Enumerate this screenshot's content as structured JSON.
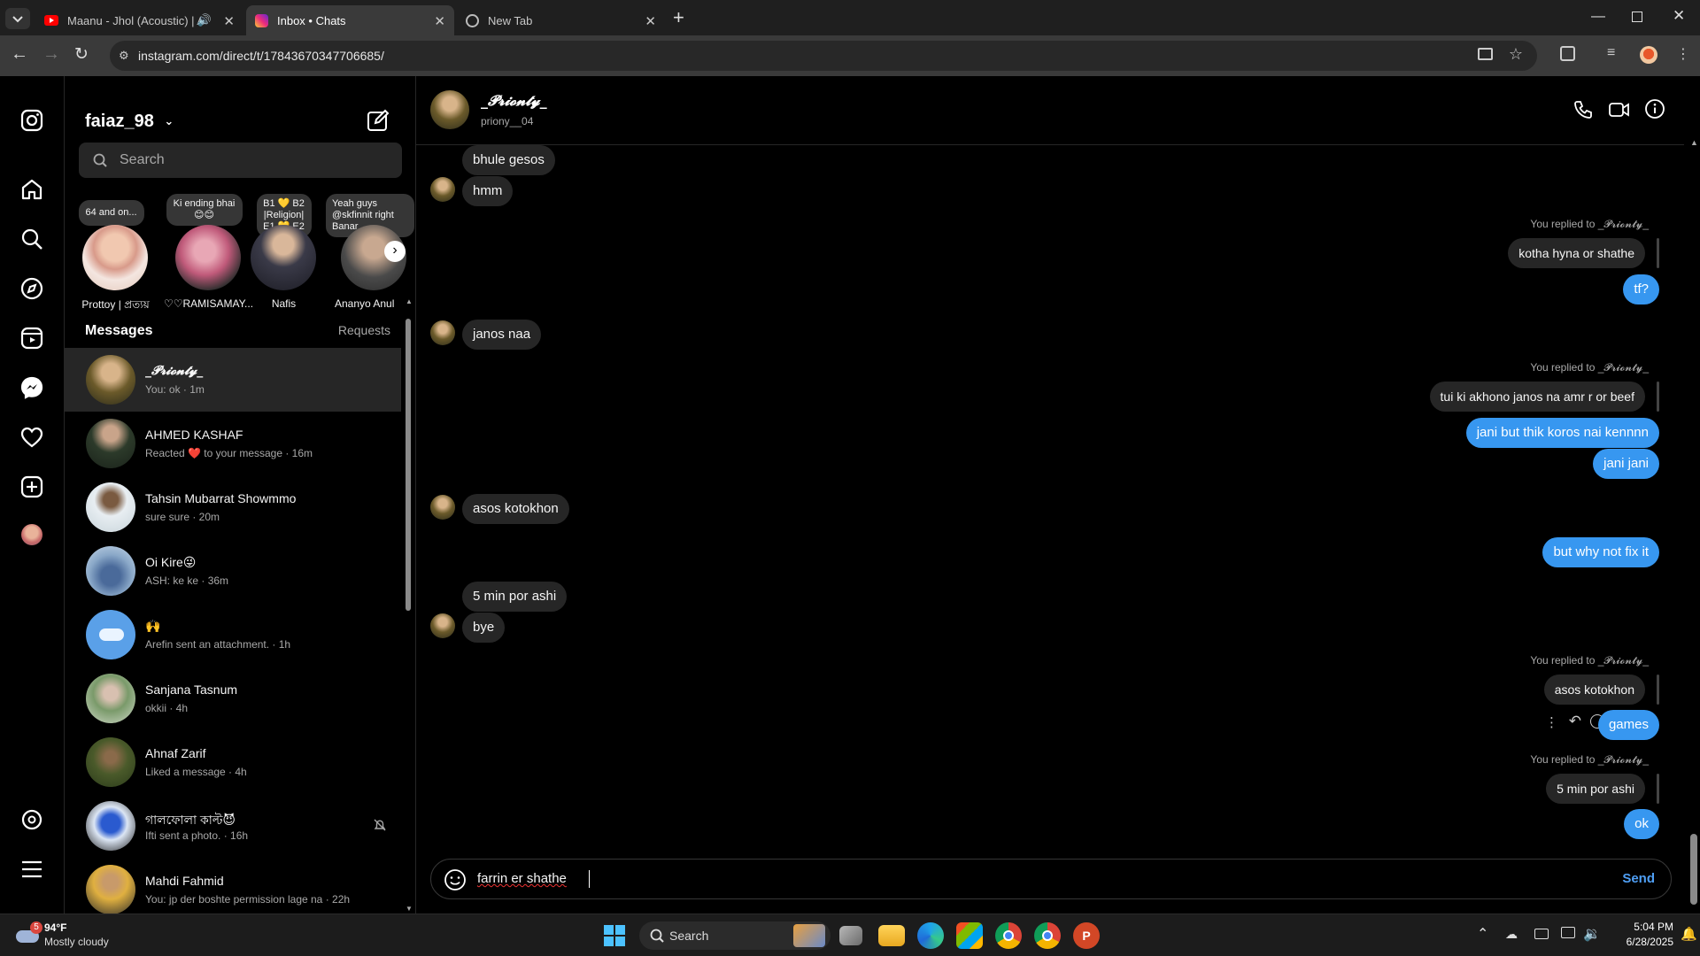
{
  "browser": {
    "tabs": [
      {
        "title": "Maanu - Jhol (Acoustic) | Ar",
        "active": false
      },
      {
        "title": "Inbox • Chats",
        "active": true
      },
      {
        "title": "New Tab",
        "active": false
      }
    ],
    "new_tab": "+",
    "url": "instagram.com/direct/t/17843670347706685/"
  },
  "inbox": {
    "username": "faiaz_98",
    "search_placeholder": "Search",
    "notes": [
      {
        "note": "64 and on...",
        "name": "Prottoy | প্রত্যয়"
      },
      {
        "note": "Ki ending bhai 😊😊",
        "name": "♡♡RAMISAMAY..."
      },
      {
        "note": "B1 💛 B2 |Religion| E1 💛 E2",
        "name": "Nafis"
      },
      {
        "note": "Yeah guys @skfinnit right Banar",
        "name": "Ananyo Anul"
      }
    ],
    "messages_heading": "Messages",
    "requests_label": "Requests",
    "conversations": [
      {
        "name": "_𝓟𝓻𝓲𝓸𝓷𝓽𝔂_",
        "preview": "You: ok · 1m",
        "active": true
      },
      {
        "name": "AHMED KASHAF",
        "preview": "Reacted ❤️ to your message · 16m",
        "active": false
      },
      {
        "name": "Tahsin Mubarrat Showmmo",
        "preview": "sure sure · 20m",
        "active": false
      },
      {
        "name": "Oi Kire😜",
        "preview": "ASH: ke ke · 36m",
        "active": false
      },
      {
        "name": "🙌",
        "preview": "Arefin sent an attachment. · 1h",
        "active": false
      },
      {
        "name": "Sanjana Tasnum",
        "preview": "okkii · 4h",
        "active": false
      },
      {
        "name": "Ahnaf Zarif",
        "preview": "Liked a message · 4h",
        "active": false
      },
      {
        "name": "গালফোলা কাল্ট😈",
        "preview": "Ifti sent a photo. · 16h",
        "active": false
      },
      {
        "name": "Mahdi Fahmid",
        "preview": "You: jp der boshte permission lage na · 22h",
        "active": false
      }
    ]
  },
  "chat": {
    "title": "_𝓟𝓻𝓲𝓸𝓷𝓽𝔂_",
    "subtitle": "priony__04",
    "reply_label": "You replied to _𝓟𝓻𝓲𝓸𝓷𝓽𝔂_",
    "messages": {
      "m1": "bhule gesos",
      "m2": "hmm",
      "q1": "kotha hyna or shathe",
      "m3": "tf?",
      "m4": "janos naa",
      "q2": "tui ki akhono janos na amr r or beef",
      "m5": "jani but thik koros nai kennnn",
      "m6": "jani jani",
      "m7": "asos kotokhon",
      "m8": "but why not fix it",
      "m9": "5 min por ashi",
      "m10": "bye",
      "q3": "asos kotokhon",
      "m11": "games",
      "q4": "5 min por ashi",
      "m12": "ok"
    },
    "composer_text": "farrin er shathe",
    "send_label": "Send"
  },
  "taskbar": {
    "weather_temp": "94°F",
    "weather_desc": "Mostly cloudy",
    "weather_badge": "5",
    "search_label": "Search",
    "time": "5:04 PM",
    "date": "6/28/2025"
  },
  "colors": {
    "outgoing_bubble": "#3797f0",
    "incoming_bubble": "#262626",
    "send_text": "#4f9ff5"
  }
}
